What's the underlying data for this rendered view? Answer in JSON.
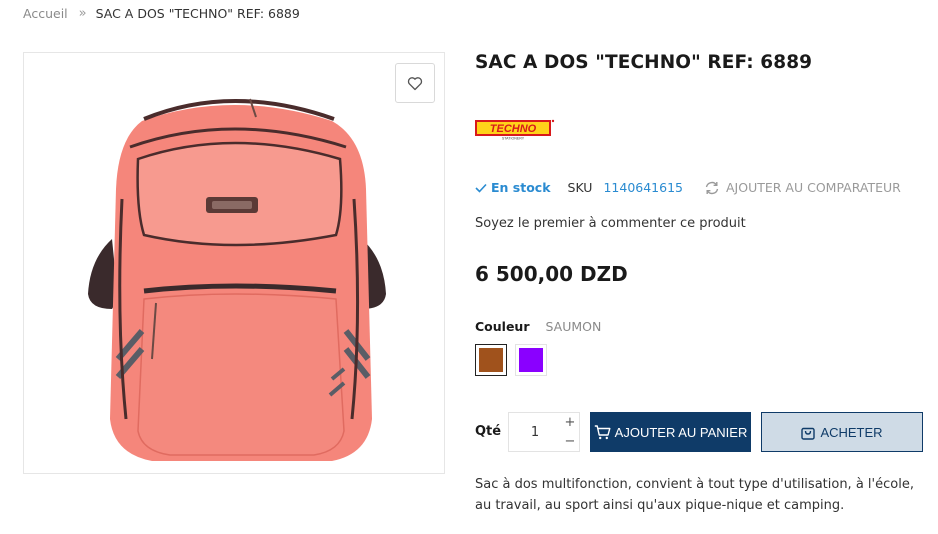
{
  "breadcrumb": {
    "home": "Accueil",
    "separator": "»",
    "current": "SAC A DOS \"TECHNO\" REF: 6889"
  },
  "product": {
    "title": "SAC A DOS \"TECHNO\" REF: 6889",
    "brand_logo_text": "TECHNO",
    "brand_logo_subtext": "STATIONERY",
    "stock_status": "En stock",
    "sku_label": "SKU",
    "sku_value": "1140641615",
    "compare_label": "AJOUTER AU COMPARATEUR",
    "review_prompt": "Soyez le premier à commenter ce produit",
    "price": "6 500,00 DZD",
    "color_label": "Couleur",
    "color_value": "SAUMON",
    "swatches": [
      {
        "name": "brown",
        "color": "#a0521c",
        "selected": true
      },
      {
        "name": "purple",
        "color": "#8a00ff",
        "selected": false
      }
    ],
    "quantity_label": "Qté",
    "quantity_value": "1",
    "add_to_cart_label": "AJOUTER AU PANIER",
    "buy_label": "ACHETER",
    "description": "Sac à dos multifonction, convient à tout type d'utilisation, à l'école, au travail, au sport ainsi qu'aux pique-nique et camping.",
    "image_icon": "heart-icon"
  },
  "colors": {
    "primary": "#0f3b68",
    "secondary_bg": "#cfdbe6",
    "accent": "#2a8bd1",
    "bag": "#f5867b"
  }
}
